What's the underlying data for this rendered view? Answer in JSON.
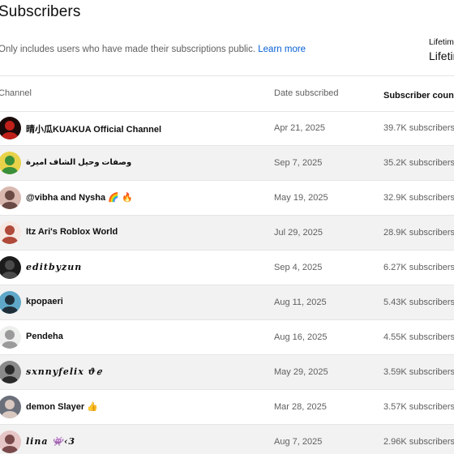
{
  "page": {
    "title": "Subscribers",
    "note": "Only includes users who have made their subscriptions public.",
    "learn_more": "Learn more",
    "lifetime_label": "Lifetim",
    "lifetime_value": "Lifetim"
  },
  "table": {
    "headers": {
      "channel": "Channel",
      "date": "Date subscribed",
      "count": "Subscriber count",
      "sort_icon": "arrow-down-icon"
    },
    "rows": [
      {
        "name": "晴小瓜KUAKUA Official Channel",
        "date": "Apr 21, 2025",
        "count": "39.7K subscribers",
        "avatar_colors": [
          "#1a0a0a",
          "#c0201a"
        ]
      },
      {
        "name": "وصفات وحيل الشاف اميرة",
        "date": "Sep 7, 2025",
        "count": "35.2K subscribers",
        "avatar_colors": [
          "#e8d24a",
          "#3a8f3a"
        ]
      },
      {
        "name": "@vibha and Nysha 🌈 🔥",
        "date": "May 19, 2025",
        "count": "32.9K subscribers",
        "avatar_colors": [
          "#d9b8b0",
          "#6a4a44"
        ]
      },
      {
        "name": "Itz Ari's Roblox World",
        "date": "Jul 29, 2025",
        "count": "28.9K subscribers",
        "avatar_colors": [
          "#f6e8e2",
          "#b04a3a"
        ]
      },
      {
        "name": "editbyzun",
        "date": "Sep 4, 2025",
        "count": "6.27K subscribers",
        "avatar_colors": [
          "#1b1b1b",
          "#4a4a4a"
        ]
      },
      {
        "name": "kpopaeri",
        "date": "Aug 11, 2025",
        "count": "5.43K subscribers",
        "avatar_colors": [
          "#5fa7c9",
          "#1f2f3a"
        ]
      },
      {
        "name": "Pendeha",
        "date": "Aug 16, 2025",
        "count": "4.55K subscribers",
        "avatar_colors": [
          "#eef0ee",
          "#9a9a9a"
        ]
      },
      {
        "name": "sxnnyfelix ϑℯ",
        "date": "May 29, 2025",
        "count": "3.59K subscribers",
        "avatar_colors": [
          "#8a8a8a",
          "#2a2a2a"
        ]
      },
      {
        "name": "demon Slayer 👍",
        "date": "Mar 28, 2025",
        "count": "3.57K subscribers",
        "avatar_colors": [
          "#6a6f7a",
          "#d8c8c0"
        ]
      },
      {
        "name": "lina 👾‹3",
        "date": "Aug 7, 2025",
        "count": "2.96K subscribers",
        "avatar_colors": [
          "#e6c6c6",
          "#7a4a4a"
        ]
      }
    ]
  }
}
